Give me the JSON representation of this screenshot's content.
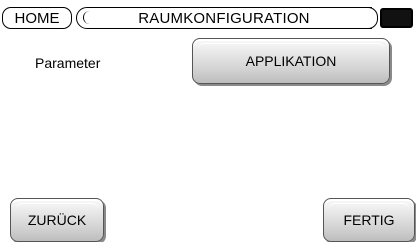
{
  "header": {
    "home_label": "HOME",
    "title": "RAUMKONFIGURATION",
    "status_indicator": "status-block"
  },
  "main": {
    "parameter_label": "Parameter",
    "application_button_label": "APPLIKATION"
  },
  "footer": {
    "back_label": "ZURÜCK",
    "done_label": "FERTIG"
  },
  "colors": {
    "background": "#ffffff",
    "text": "#000000",
    "button_face": "#d2d2d2",
    "status_block": "#111111"
  }
}
